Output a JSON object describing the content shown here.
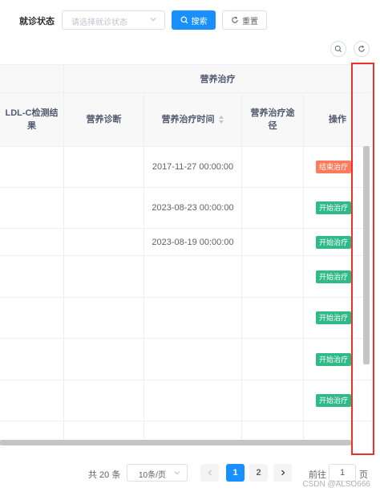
{
  "filter": {
    "label": "就诊状态",
    "select_placeholder": "请选择就诊状态",
    "search_label": "搜索",
    "reset_label": "重置"
  },
  "table": {
    "group_header": "营养治疗",
    "columns": [
      "LDL-C检测结果",
      "营养诊断",
      "营养治疗时间",
      "营养治疗途径",
      "操作"
    ],
    "rows": [
      {
        "ldl": "",
        "diagnosis": "",
        "time": "2017-11-27 00:00:00",
        "route": "",
        "action": "结束治疗",
        "action_type": "end"
      },
      {
        "ldl": "",
        "diagnosis": "",
        "time": "2023-08-23 00:00:00",
        "route": "",
        "action": "开始治疗",
        "action_type": "start"
      },
      {
        "ldl": "",
        "diagnosis": "",
        "time": "2023-08-19 00:00:00",
        "route": "",
        "action": "开始治疗",
        "action_type": "start"
      },
      {
        "ldl": "",
        "diagnosis": "",
        "time": "",
        "route": "",
        "action": "开始治疗",
        "action_type": "start"
      },
      {
        "ldl": "",
        "diagnosis": "",
        "time": "",
        "route": "",
        "action": "开始治疗",
        "action_type": "start"
      },
      {
        "ldl": "",
        "diagnosis": "",
        "time": "",
        "route": "",
        "action": "开始治疗",
        "action_type": "start"
      },
      {
        "ldl": "",
        "diagnosis": "",
        "time": "",
        "route": "",
        "action": "开始治疗",
        "action_type": "start"
      },
      {
        "ldl": "",
        "diagnosis": "",
        "time": "",
        "route": "",
        "action": "",
        "action_type": "start"
      }
    ]
  },
  "pagination": {
    "total": "共 20 条",
    "page_size": "10条/页",
    "pages": [
      "1",
      "2"
    ],
    "current_page": "1",
    "goto_label": "前往",
    "goto_value": "1",
    "page_suffix": "页"
  },
  "watermark": "CSDN @ALSO666",
  "colors": {
    "primary": "#1890ff",
    "tag_end": "#ff7b5c",
    "tag_start": "#2fba88",
    "highlight_box": "#e8322b"
  }
}
